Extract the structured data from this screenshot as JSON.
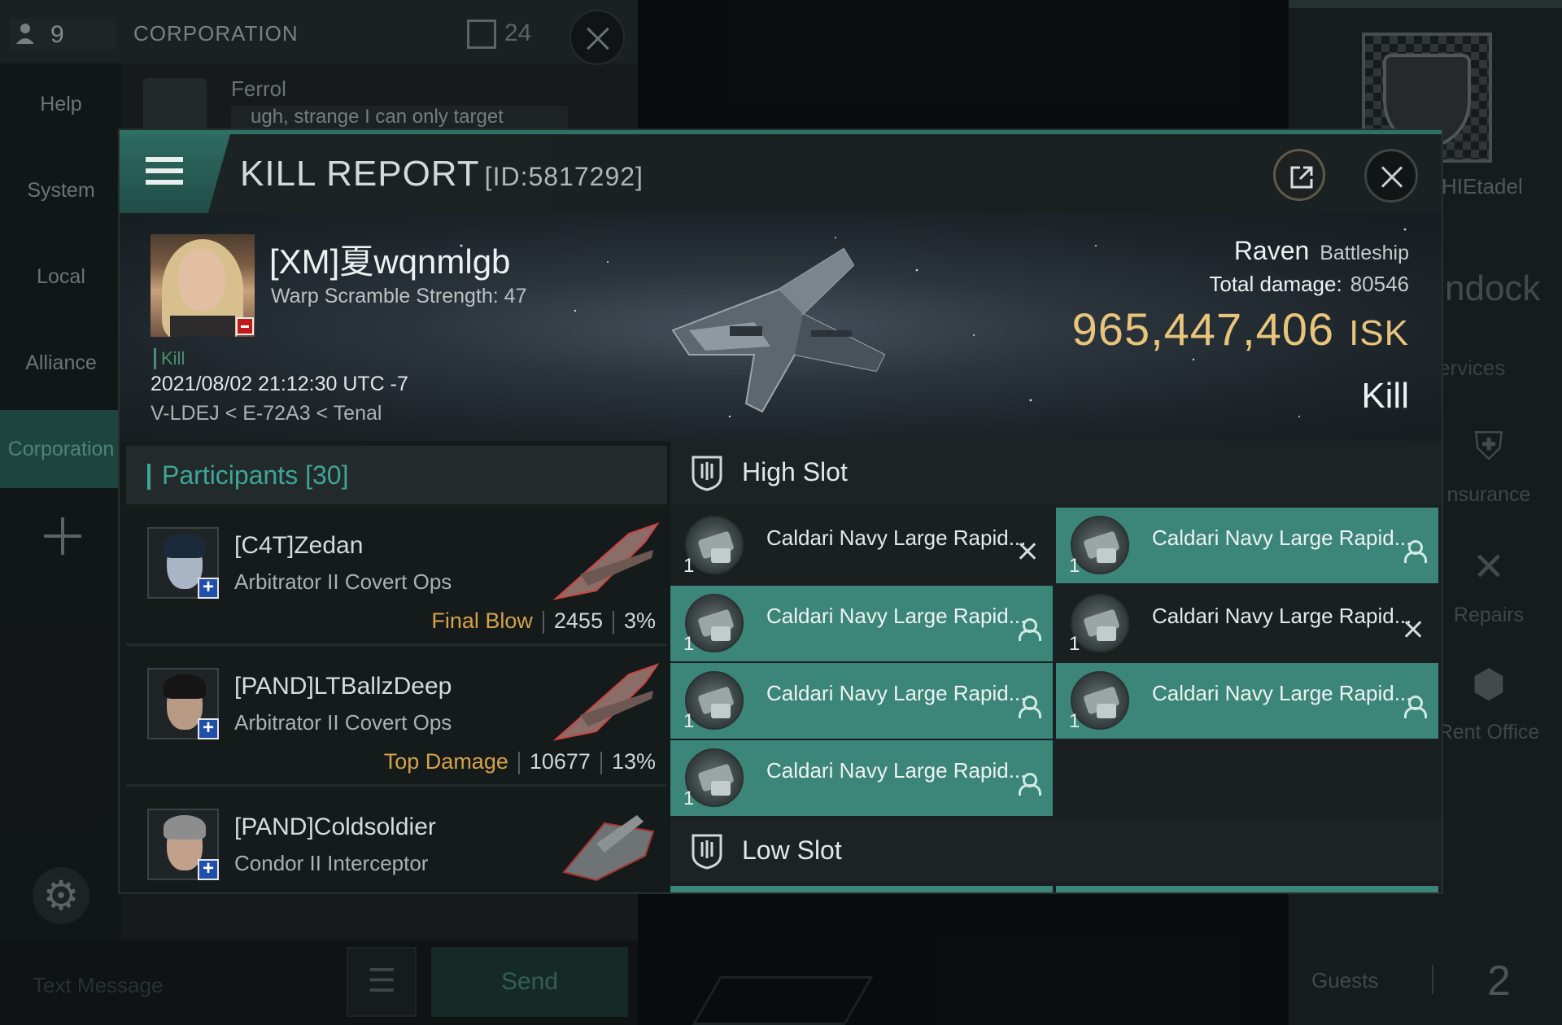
{
  "background": {
    "chat": {
      "user_count": "9",
      "title": "CORPORATION",
      "unread_count": "24",
      "nav": [
        "Help",
        "System",
        "Local",
        "Alliance",
        "Corporation"
      ],
      "message_author": "Ferrol",
      "message_text": "ugh, strange I can only target",
      "input_placeholder": "Text Message",
      "send_label": "Send",
      "menu_glyph": "☰",
      "gear_glyph": "⚙"
    },
    "station": {
      "name": "HIEtadel",
      "undock": "ndock",
      "services": "ervices",
      "insurance": "nsurance",
      "repairs": "Repairs",
      "rent_office": "Rent Office",
      "guests_label": "Guests",
      "guests_count": "2"
    }
  },
  "report": {
    "title": "KILL REPORT",
    "id": "[ID:5817292]",
    "victim": {
      "name": "[XM]夏wqnmlgb",
      "scramble": "Warp Scramble Strength: 47",
      "tag": "Kill",
      "datetime": "2021/08/02 21:12:30 UTC -7",
      "location": "V-LDEJ < E-72A3 < Tenal",
      "ship": "Raven",
      "ship_class": "Battleship",
      "damage_label": "Total damage:",
      "damage_value": "80546",
      "isk_value": "965,447,406",
      "isk_unit": "ISK",
      "result": "Kill"
    },
    "participants_label": "Participants",
    "participants_count": "[30]",
    "participants": [
      {
        "name": "[C4T]Zedan",
        "ship": "Arbitrator II Covert Ops",
        "tag": "Final Blow",
        "damage": "2455",
        "percent": "3%"
      },
      {
        "name": "[PAND]LTBallzDeep",
        "ship": "Arbitrator II Covert Ops",
        "tag": "Top Damage",
        "damage": "10677",
        "percent": "13%"
      },
      {
        "name": "[PAND]Coldsoldier",
        "ship": "Condor II Interceptor",
        "tag": "",
        "damage": "",
        "percent": ""
      }
    ],
    "high_slot_label": "High Slot",
    "low_slot_label": "Low Slot",
    "high_slot_modules": [
      {
        "name": "Caldari Navy Large Rapid...",
        "qty": "1",
        "status": "destroyed-icon",
        "highlighted": false
      },
      {
        "name": "Caldari Navy Large Rapid...",
        "qty": "1",
        "status": "dropped-icon",
        "highlighted": true
      },
      {
        "name": "Caldari Navy Large Rapid...",
        "qty": "1",
        "status": "dropped-icon",
        "highlighted": true
      },
      {
        "name": "Caldari Navy Large Rapid...",
        "qty": "1",
        "status": "destroyed-icon",
        "highlighted": false
      },
      {
        "name": "Caldari Navy Large Rapid...",
        "qty": "1",
        "status": "dropped-icon",
        "highlighted": true
      },
      {
        "name": "Caldari Navy Large Rapid...",
        "qty": "1",
        "status": "dropped-icon",
        "highlighted": true
      },
      {
        "name": "Caldari Navy Large Rapid...",
        "qty": "1",
        "status": "dropped-icon",
        "highlighted": true
      }
    ]
  }
}
